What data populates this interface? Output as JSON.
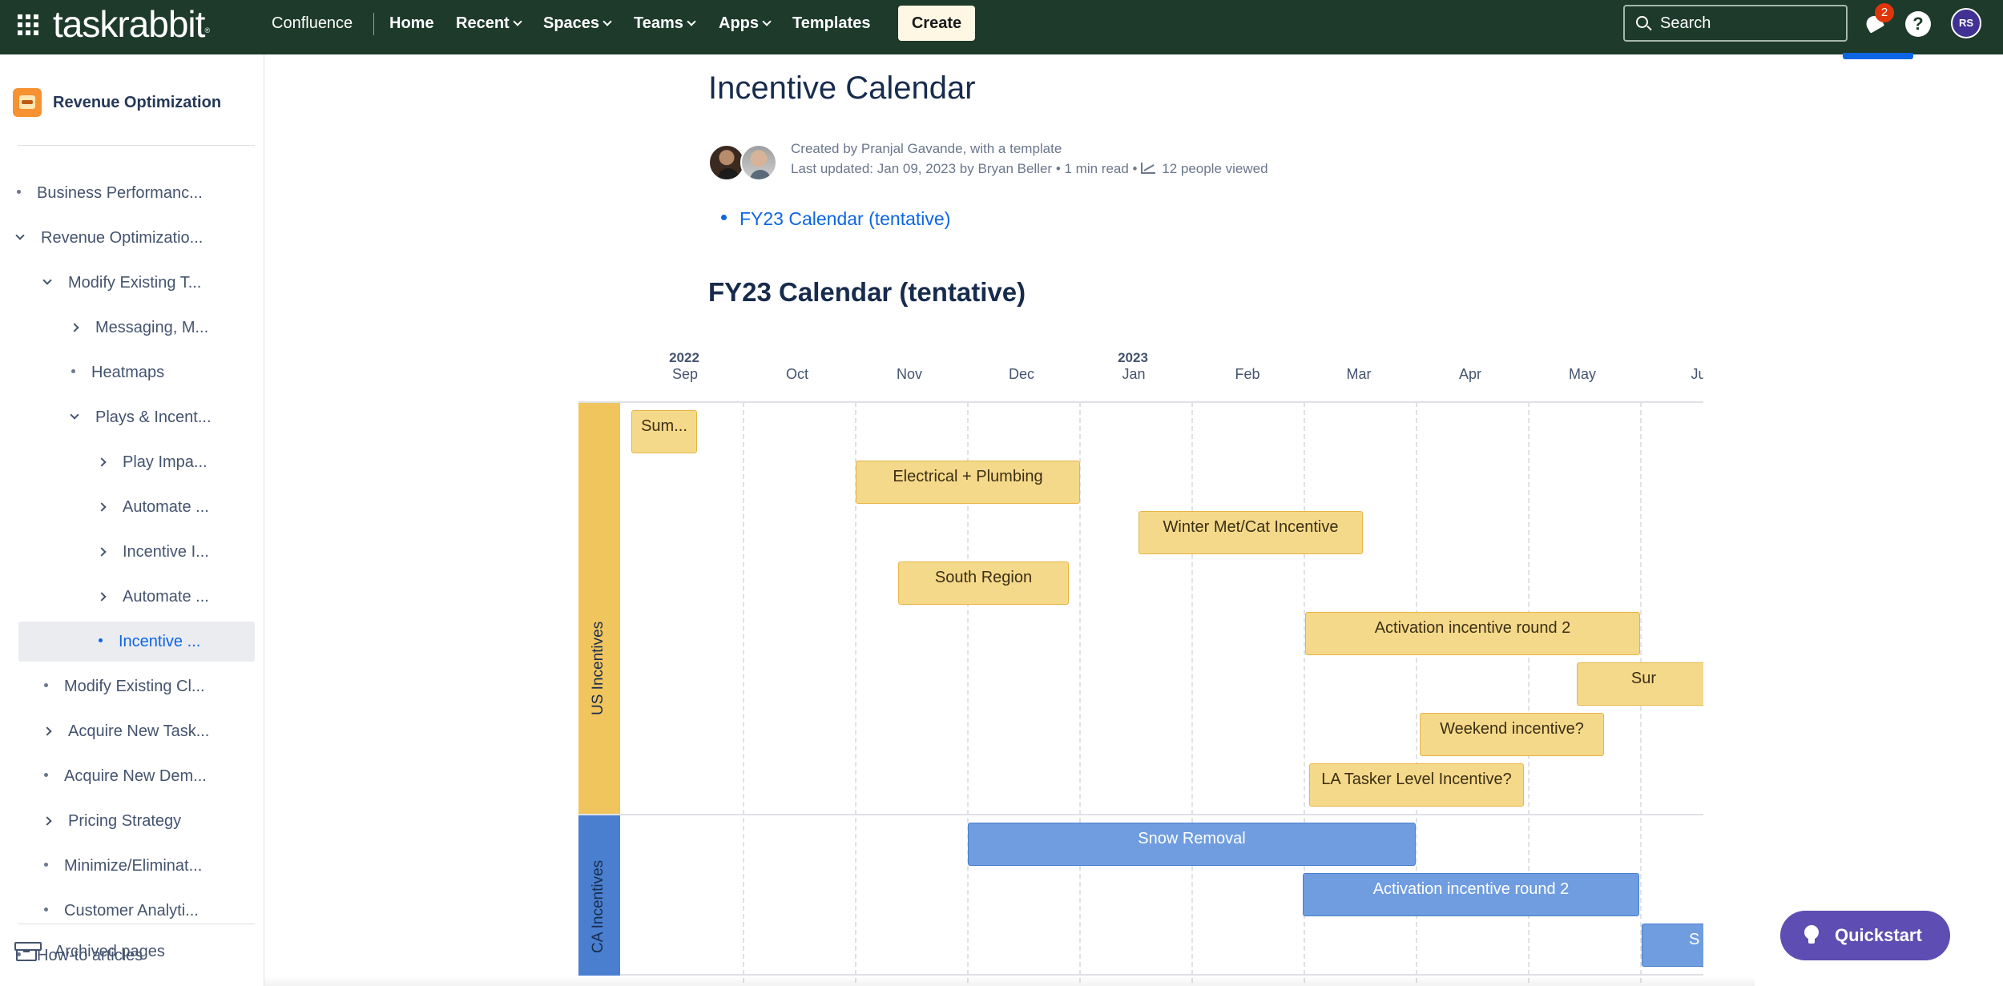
{
  "topnav": {
    "logo": "taskrabbit",
    "logo_mark": "®",
    "confluence": "Confluence",
    "home": "Home",
    "recent": "Recent",
    "spaces": "Spaces",
    "teams": "Teams",
    "apps": "Apps",
    "templates": "Templates",
    "create": "Create",
    "search_placeholder": "Search",
    "notification_count": "2",
    "help": "?",
    "user_initials": "RS"
  },
  "sidebar": {
    "space_name": "Revenue Optimization",
    "items": [
      {
        "label": "Business Performanc...",
        "kind": "bullet",
        "indent": 0
      },
      {
        "label": "Revenue Optimizatio...",
        "kind": "expanded",
        "indent": 0
      },
      {
        "label": "Modify Existing T...",
        "kind": "expanded",
        "indent": 1
      },
      {
        "label": "Messaging, M...",
        "kind": "collapsed",
        "indent": 2
      },
      {
        "label": "Heatmaps",
        "kind": "bullet",
        "indent": 2
      },
      {
        "label": "Plays & Incent...",
        "kind": "expanded",
        "indent": 2
      },
      {
        "label": "Play Impa...",
        "kind": "collapsed",
        "indent": 3
      },
      {
        "label": "Automate ...",
        "kind": "collapsed",
        "indent": 3
      },
      {
        "label": "Incentive I...",
        "kind": "collapsed",
        "indent": 3
      },
      {
        "label": "Automate ...",
        "kind": "collapsed",
        "indent": 3
      },
      {
        "label": "Incentive ...",
        "kind": "bullet",
        "indent": 3,
        "selected": true
      },
      {
        "label": "Modify Existing Cl...",
        "kind": "bullet",
        "indent": 1
      },
      {
        "label": "Acquire New Task...",
        "kind": "collapsed",
        "indent": 1
      },
      {
        "label": "Acquire New Dem...",
        "kind": "bullet",
        "indent": 1
      },
      {
        "label": "Pricing Strategy",
        "kind": "collapsed",
        "indent": 1
      },
      {
        "label": "Minimize/Eliminat...",
        "kind": "bullet",
        "indent": 1
      },
      {
        "label": "Customer Analyti...",
        "kind": "bullet",
        "indent": 1
      },
      {
        "label": "How-to articles",
        "kind": "bullet",
        "indent": 0
      }
    ],
    "archived": "Archived pages"
  },
  "page": {
    "title": "Incentive Calendar",
    "created_prefix": "Created by ",
    "created_by": "Pranjal Gavande",
    "created_suffix": ", with a template",
    "updated_prefix": "Last updated: ",
    "updated_date": "Jan 09, 2023",
    "updated_by_prefix": " by ",
    "updated_by": "Bryan Beller",
    "sep1": " • ",
    "read_time": "1 min read",
    "sep2": " • ",
    "views": "12 people viewed",
    "toc_link": "FY23 Calendar (tentative)",
    "section_heading": "FY23 Calendar (tentative)"
  },
  "calendar": {
    "years": [
      "2022",
      "2023"
    ],
    "months": [
      "Sep",
      "Oct",
      "Nov",
      "Dec",
      "Jan",
      "Feb",
      "Mar",
      "Apr",
      "May",
      "Ju"
    ],
    "groups": [
      {
        "name": "US Incentives",
        "color": "#f0c55e"
      },
      {
        "name": "CA Incentives",
        "color": "#4a7fcf"
      }
    ],
    "us_events": [
      "Sum...",
      "Electrical + Plumbing",
      "Winter Met/Cat Incentive",
      "South Region",
      "Activation incentive round 2",
      "Sur",
      "Weekend incentive?",
      "LA Tasker Level Incentive?"
    ],
    "ca_events": [
      "Snow Removal",
      "Activation incentive round 2",
      "S"
    ]
  },
  "quickstart": "Quickstart",
  "colors": {
    "topbar": "#1d3a2a",
    "accent": "#0c66e4",
    "us_event": "#f5d98a",
    "ca_event": "#6f9de0",
    "quickstart": "#5e4db2"
  }
}
